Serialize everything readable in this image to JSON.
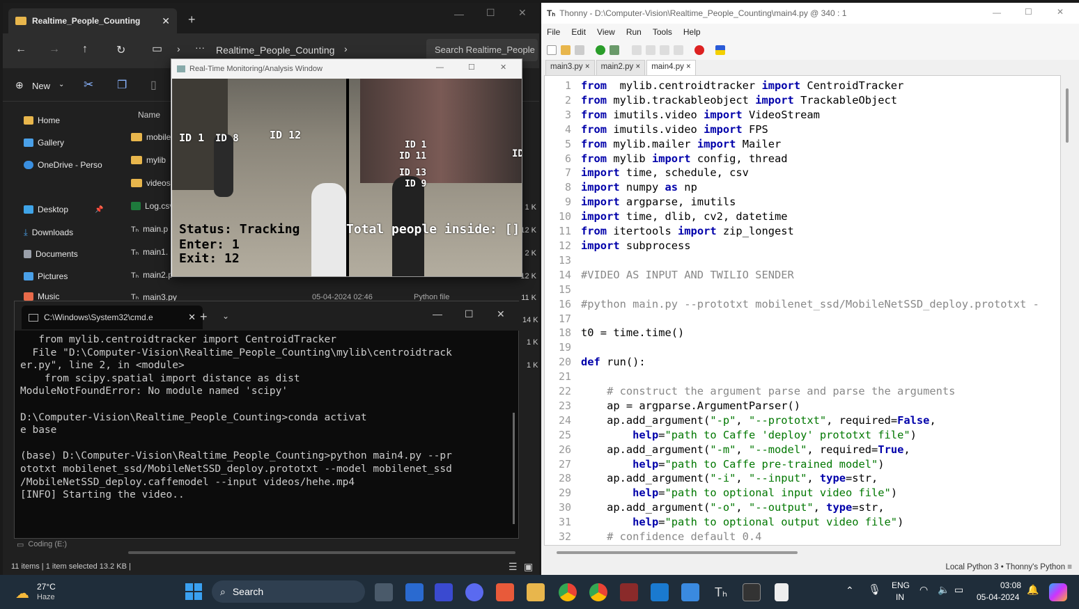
{
  "explorer": {
    "tab_title": "Realtime_People_Counting",
    "breadcrumb": "Realtime_People_Counting",
    "search_placeholder": "Search Realtime_People",
    "new_label": "New",
    "column_name": "Name",
    "sidebar": [
      {
        "label": "Home",
        "color": "#e8b64c"
      },
      {
        "label": "Gallery",
        "color": "#4aa0e8"
      },
      {
        "label": "OneDrive - Perso",
        "color": "#3a8fe0"
      },
      {
        "label": "Desktop",
        "color": "#3fa4e8"
      },
      {
        "label": "Downloads",
        "color": "#4aa0e8"
      },
      {
        "label": "Documents",
        "color": "#9aa0aa"
      },
      {
        "label": "Pictures",
        "color": "#4aa0e8"
      },
      {
        "label": "Music",
        "color": "#e86a4a"
      }
    ],
    "files": [
      {
        "name": "mobile",
        "size": ""
      },
      {
        "name": "mylib",
        "size": ""
      },
      {
        "name": "videos",
        "size": ""
      },
      {
        "name": "Log.csv",
        "size": "1 K"
      },
      {
        "name": "main.p",
        "size": "12 K"
      },
      {
        "name": "main1.",
        "size": "2 K"
      },
      {
        "name": "main2.p",
        "size": "12 K"
      },
      {
        "name": "main3.py",
        "size": "11 K"
      }
    ],
    "main3_date": "05-04-2024 02:46",
    "main3_type": "Python file",
    "extra_sizes": [
      "14 K",
      "1 K",
      "1 K"
    ],
    "coding_drive": "Coding (E:)",
    "status": "11 items  |  1 item selected  13.2 KB  |"
  },
  "video": {
    "title": "Real-Time Monitoring/Analysis Window",
    "status": "Status: Tracking",
    "enter": "Enter: 1",
    "exit": "Exit: 12",
    "total": "Total people inside: []",
    "ids": [
      "ID 1",
      "ID 8",
      "ID 12",
      "ID 1",
      "ID 11",
      "ID 13",
      "ID 9",
      "ID"
    ]
  },
  "cmd": {
    "tab_title": "C:\\Windows\\System32\\cmd.e",
    "lines": [
      "   from mylib.centroidtracker import CentroidTracker",
      "  File \"D:\\Computer-Vision\\Realtime_People_Counting\\mylib\\centroidtrack",
      "er.py\", line 2, in <module>",
      "    from scipy.spatial import distance as dist",
      "ModuleNotFoundError: No module named 'scipy'",
      "",
      "D:\\Computer-Vision\\Realtime_People_Counting>conda activat",
      "e base",
      "",
      "(base) D:\\Computer-Vision\\Realtime_People_Counting>python main4.py --pr",
      "ototxt mobilenet_ssd/MobileNetSSD_deploy.prototxt --model mobilenet_ssd",
      "/MobileNetSSD_deploy.caffemodel --input videos/hehe.mp4",
      "[INFO] Starting the video.."
    ]
  },
  "thonny": {
    "title": "Thonny  -  D:\\Computer-Vision\\Realtime_People_Counting\\main4.py  @  340 : 1",
    "menu": [
      "File",
      "Edit",
      "View",
      "Run",
      "Tools",
      "Help"
    ],
    "tabs": [
      "main3.py",
      "main2.py",
      "main4.py"
    ],
    "status": "Local Python 3  •  Thonny's Python  ≡",
    "code": [
      [
        [
          "kw",
          "from"
        ],
        [
          "",
          "  mylib.centroidtracker "
        ],
        [
          "kw",
          "import"
        ],
        [
          "",
          " CentroidTracker"
        ]
      ],
      [
        [
          "kw",
          "from"
        ],
        [
          "",
          " mylib.trackableobject "
        ],
        [
          "kw",
          "import"
        ],
        [
          "",
          " TrackableObject"
        ]
      ],
      [
        [
          "kw",
          "from"
        ],
        [
          "",
          " imutils.video "
        ],
        [
          "kw",
          "import"
        ],
        [
          "",
          " VideoStream"
        ]
      ],
      [
        [
          "kw",
          "from"
        ],
        [
          "",
          " imutils.video "
        ],
        [
          "kw",
          "import"
        ],
        [
          "",
          " FPS"
        ]
      ],
      [
        [
          "kw",
          "from"
        ],
        [
          "",
          " mylib.mailer "
        ],
        [
          "kw",
          "import"
        ],
        [
          "",
          " Mailer"
        ]
      ],
      [
        [
          "kw",
          "from"
        ],
        [
          "",
          " mylib "
        ],
        [
          "kw",
          "import"
        ],
        [
          "",
          " config, thread"
        ]
      ],
      [
        [
          "kw",
          "import"
        ],
        [
          "",
          " time, schedule, csv"
        ]
      ],
      [
        [
          "kw",
          "import"
        ],
        [
          "",
          " numpy "
        ],
        [
          "kw",
          "as"
        ],
        [
          "",
          " np"
        ]
      ],
      [
        [
          "kw",
          "import"
        ],
        [
          "",
          " argparse, imutils"
        ]
      ],
      [
        [
          "kw",
          "import"
        ],
        [
          "",
          " time, dlib, cv2, datetime"
        ]
      ],
      [
        [
          "kw",
          "from"
        ],
        [
          "",
          " itertools "
        ],
        [
          "kw",
          "import"
        ],
        [
          "",
          " zip_longest"
        ]
      ],
      [
        [
          "kw",
          "import"
        ],
        [
          "",
          " subprocess"
        ]
      ],
      [],
      [
        [
          "cm",
          "#VIDEO AS INPUT AND TWILIO SENDER"
        ]
      ],
      [],
      [
        [
          "cm",
          "#python main.py --prototxt mobilenet_ssd/MobileNetSSD_deploy.prototxt -"
        ]
      ],
      [],
      [
        [
          "",
          "t0 = time.time()"
        ]
      ],
      [],
      [
        [
          "kw",
          "def"
        ],
        [
          "",
          " run():"
        ]
      ],
      [],
      [
        [
          "cm",
          "    # construct the argument parse and parse the arguments"
        ]
      ],
      [
        [
          "",
          "    ap = argparse.ArgumentParser()"
        ]
      ],
      [
        [
          "",
          "    ap.add_argument("
        ],
        [
          "st",
          "\"-p\""
        ],
        [
          "",
          ", "
        ],
        [
          "st",
          "\"--prototxt\""
        ],
        [
          "",
          ", required="
        ],
        [
          "kw",
          "False"
        ],
        [
          "",
          ","
        ]
      ],
      [
        [
          "",
          "        "
        ],
        [
          "kw",
          "help"
        ],
        [
          "",
          "="
        ],
        [
          "st",
          "\"path to Caffe 'deploy' prototxt file\""
        ],
        [
          "",
          ")"
        ]
      ],
      [
        [
          "",
          "    ap.add_argument("
        ],
        [
          "st",
          "\"-m\""
        ],
        [
          "",
          ", "
        ],
        [
          "st",
          "\"--model\""
        ],
        [
          "",
          ", required="
        ],
        [
          "kw",
          "True"
        ],
        [
          "",
          ","
        ]
      ],
      [
        [
          "",
          "        "
        ],
        [
          "kw",
          "help"
        ],
        [
          "",
          "="
        ],
        [
          "st",
          "\"path to Caffe pre-trained model\""
        ],
        [
          "",
          ")"
        ]
      ],
      [
        [
          "",
          "    ap.add_argument("
        ],
        [
          "st",
          "\"-i\""
        ],
        [
          "",
          ", "
        ],
        [
          "st",
          "\"--input\""
        ],
        [
          "",
          ", "
        ],
        [
          "kw",
          "type"
        ],
        [
          "",
          "=str,"
        ]
      ],
      [
        [
          "",
          "        "
        ],
        [
          "kw",
          "help"
        ],
        [
          "",
          "="
        ],
        [
          "st",
          "\"path to optional input video file\""
        ],
        [
          "",
          ")"
        ]
      ],
      [
        [
          "",
          "    ap.add_argument("
        ],
        [
          "st",
          "\"-o\""
        ],
        [
          "",
          ", "
        ],
        [
          "st",
          "\"--output\""
        ],
        [
          "",
          ", "
        ],
        [
          "kw",
          "type"
        ],
        [
          "",
          "=str,"
        ]
      ],
      [
        [
          "",
          "        "
        ],
        [
          "kw",
          "help"
        ],
        [
          "",
          "="
        ],
        [
          "st",
          "\"path to optional output video file\""
        ],
        [
          "",
          ")"
        ]
      ],
      [
        [
          "cm",
          "    # confidence default 0.4"
        ]
      ]
    ]
  },
  "taskbar": {
    "weather_temp": "27°C",
    "weather_desc": "Haze",
    "search_label": "Search",
    "lang_top": "ENG",
    "lang_bottom": "IN",
    "time": "03:08",
    "date": "05-04-2024"
  }
}
